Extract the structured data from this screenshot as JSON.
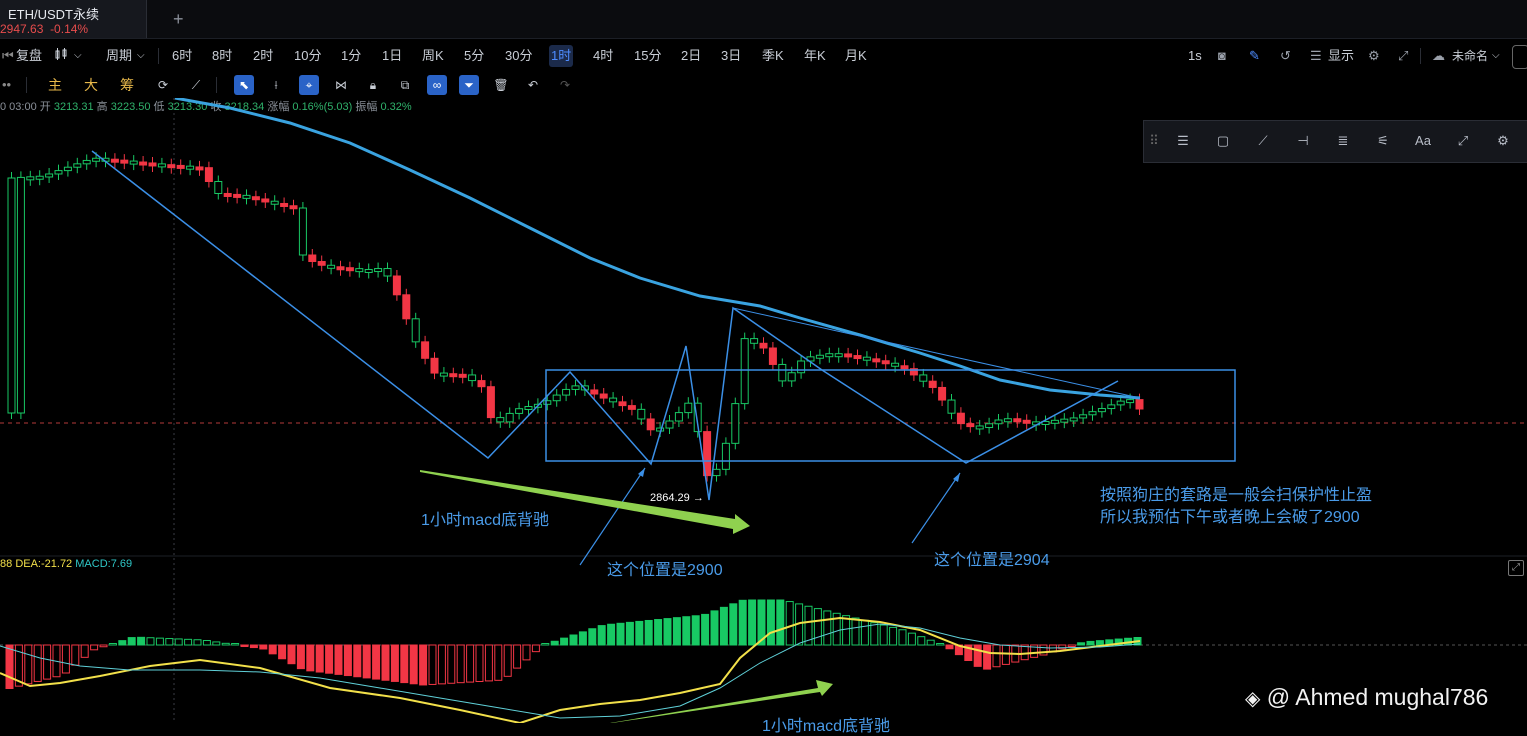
{
  "tab": {
    "title": "ETH/USDT永续",
    "price": "2947.63",
    "change": "-0.14%",
    "new_tab": "+"
  },
  "toolbar": {
    "replay": "复盘",
    "chart_type_icon": "candlestick-icon",
    "period_label": "周期",
    "intervals": [
      "6时",
      "8时",
      "2时",
      "10分",
      "1分",
      "1日",
      "周K",
      "5分",
      "30分",
      "1时",
      "4时",
      "15分",
      "2日",
      "3日",
      "季K",
      "年K",
      "月K"
    ],
    "active_interval": "1时",
    "right": {
      "seconds": "1s",
      "display": "显示",
      "layout_name": "未命名"
    }
  },
  "toolbar2": {
    "main": "主",
    "big": "大",
    "chips": "筹"
  },
  "ohlc": {
    "time": "0 03:00",
    "open_label": "开",
    "open": "3213.31",
    "high_label": "高",
    "high": "3223.50",
    "low_label": "低",
    "low": "3213.30",
    "close_label": "收",
    "close": "3218.34",
    "change_label": "涨幅",
    "change": "0.16%(5.03)",
    "amp_label": "振幅",
    "amp": "0.32%"
  },
  "annotations": {
    "low_price": "2864.29",
    "divergence_top": "1小时macd底背驰",
    "pos1": "这个位置是2900",
    "pos2": "这个位置是2904",
    "note_line1": "按照狗庄的套路是一般会扫保护性止盈",
    "note_line2": "所以我预估下午或者晚上会破了2900",
    "divergence_bottom": "1小时macd底背驰"
  },
  "macd": {
    "dif_prefix": "88",
    "dea": "DEA:-21.72",
    "macd": "MACD:7.69"
  },
  "watermark": "@ Ahmed mughal786",
  "colors": {
    "up": "#18c964",
    "down": "#f23645",
    "ma": "#3aa3e0",
    "drawing": "#3b8fe6",
    "dif": "#f2e04a",
    "dea": "#5fd0d8",
    "green_arrow": "#8fd14f"
  }
}
